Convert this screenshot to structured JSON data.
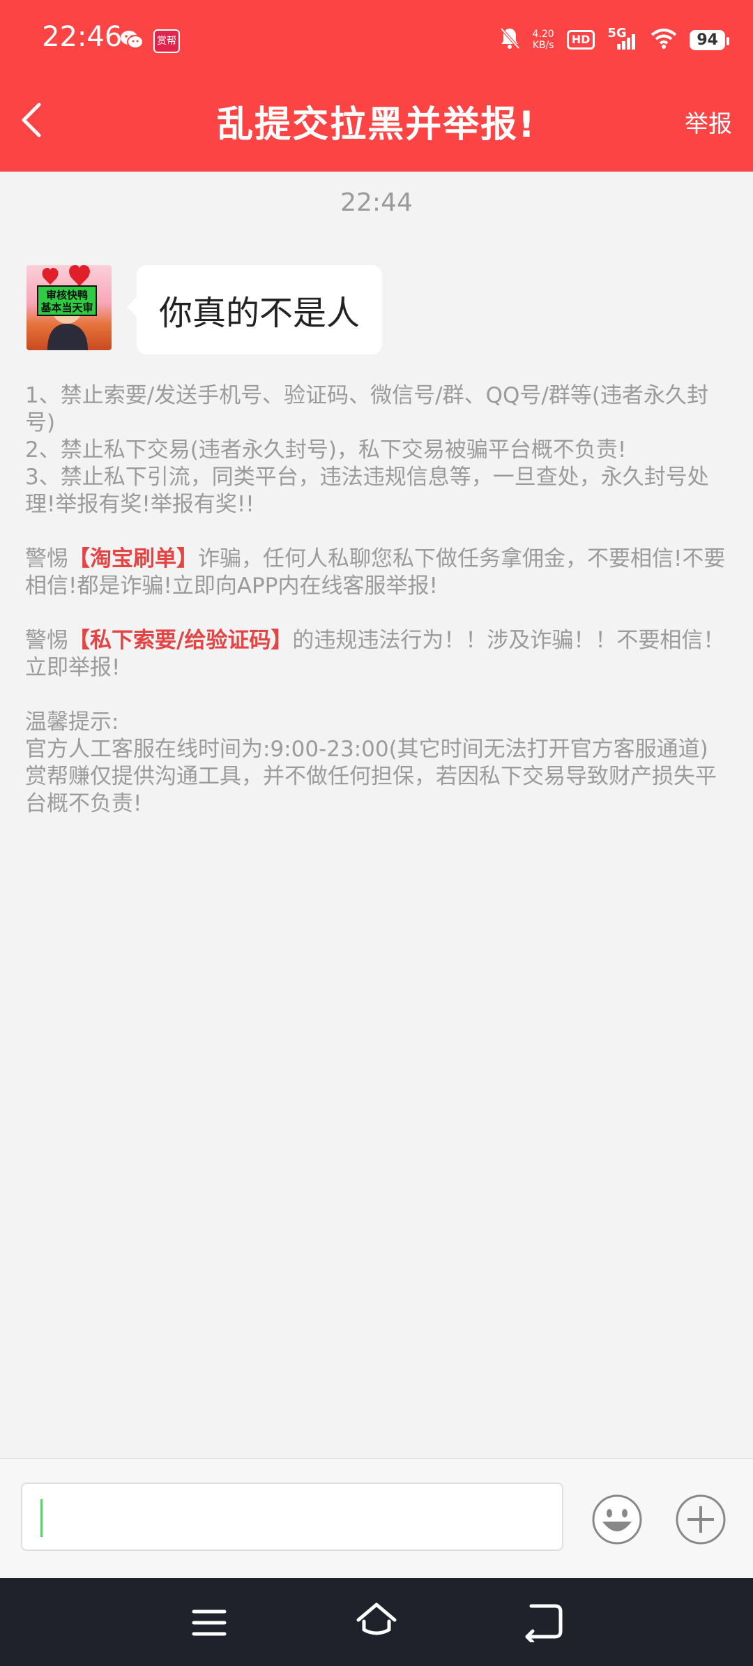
{
  "status_bar": {
    "time": "22:46",
    "app_badge": "赏帮",
    "network_rate": "4.20",
    "network_unit": "KB/s",
    "hd_label": "HD",
    "network_type": "5G",
    "battery": "94",
    "icons": [
      "wechat-icon",
      "app-badge-icon",
      "mute-bell-icon",
      "hd-icon",
      "signal-icon",
      "wifi-icon",
      "battery-icon"
    ]
  },
  "header": {
    "title": "乱提交拉黑并举报!",
    "report_label": "举报",
    "background": "#fc4444"
  },
  "chat": {
    "timestamp": "22:44",
    "message": "你真的不是人"
  },
  "notice": {
    "rule1": "1、禁止索要/发送手机号、验证码、微信号/群、QQ号/群等(违者永久封号)",
    "rule2": "2、禁止私下交易(违者永久封号)，私下交易被骗平台概不负责!",
    "rule3": "3、禁止私下引流，同类平台，违法违规信息等，一旦查处，永久封号处理!举报有奖!举报有奖!!",
    "warn1_prefix": "警惕",
    "warn1_highlight": "【淘宝刷单】",
    "warn1_suffix": "诈骗，任何人私聊您私下做任务拿佣金，不要相信!不要相信!都是诈骗!立即向APP内在线客服举报!",
    "warn2_prefix": "警惕",
    "warn2_highlight": "【私下索要/给验证码】",
    "warn2_suffix": "的违规违法行为！！涉及诈骗！！不要相信！立即举报!",
    "tip_title": "温馨提示:",
    "tip1": "官方人工客服在线时间为:9:00-23:00(其它时间无法打开官方客服通道)",
    "tip2": "赏帮赚仅提供沟通工具，并不做任何担保，若因私下交易导致财产损失平台概不负责!",
    "highlight_color": "#e34444"
  },
  "input_bar": {
    "value": "",
    "icons": [
      "emoji-icon",
      "plus-icon"
    ]
  },
  "nav_bar": {
    "icons": [
      "menu-icon",
      "home-icon",
      "back-icon"
    ]
  }
}
